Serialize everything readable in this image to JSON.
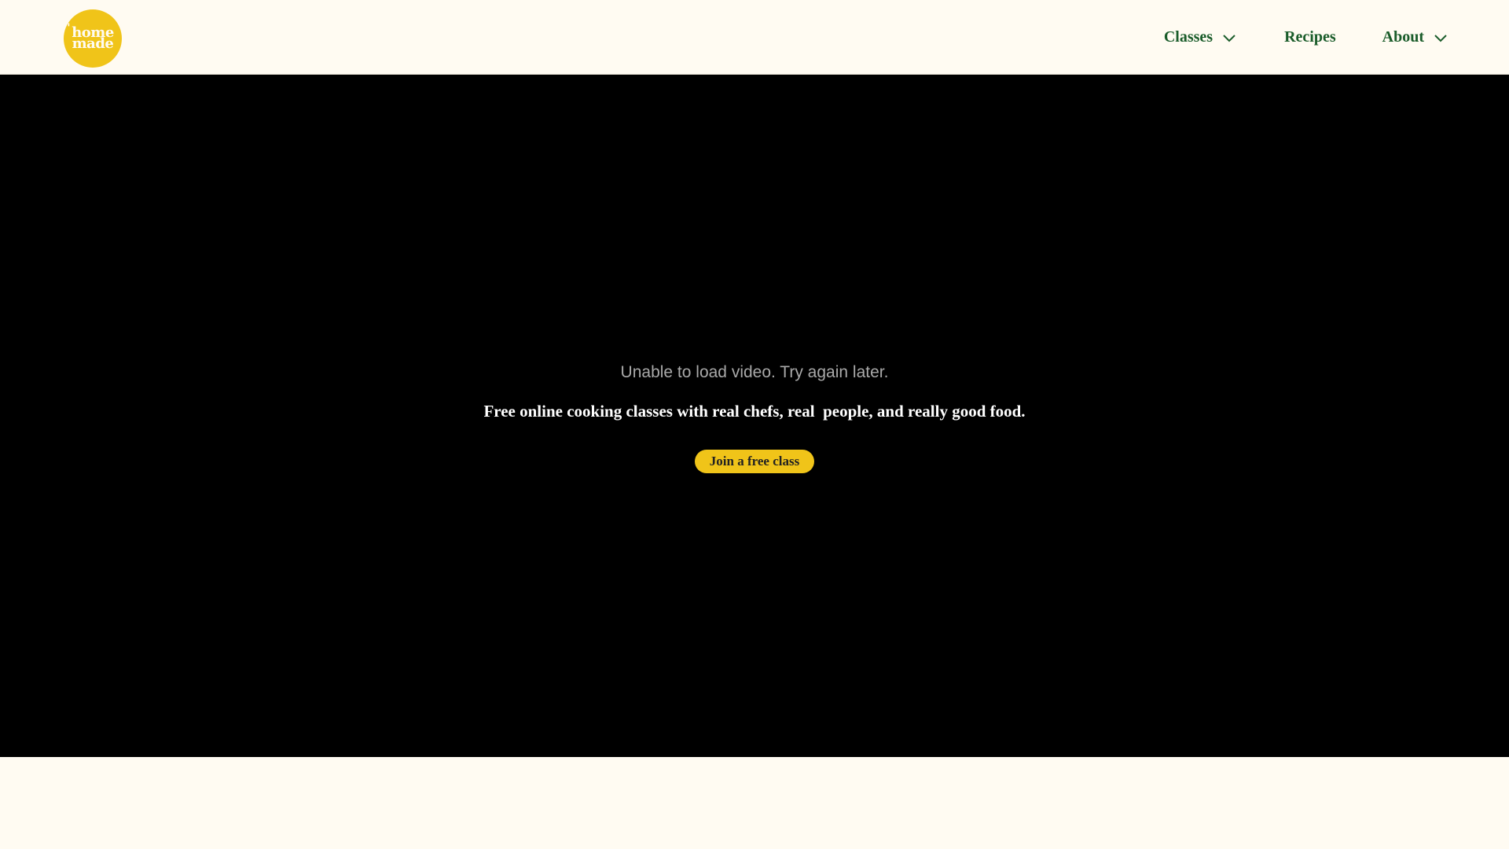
{
  "header": {
    "logo": {
      "line1": "home",
      "line2": "made",
      "color": "#f0c419"
    },
    "nav": {
      "classes_label": "Classes",
      "recipes_label": "Recipes",
      "about_label": "About"
    },
    "nav_color": "#1a5c2a"
  },
  "hero": {
    "video_error": "Unable to load video. Try again later.",
    "tagline": "Free online cooking classes with real chefs, real  people, and really good food.",
    "cta_label": "Join a free class",
    "background": "#000000"
  },
  "icons": {
    "classes_dropdown": "chevron-down-icon",
    "about_dropdown": "chevron-down-icon"
  }
}
